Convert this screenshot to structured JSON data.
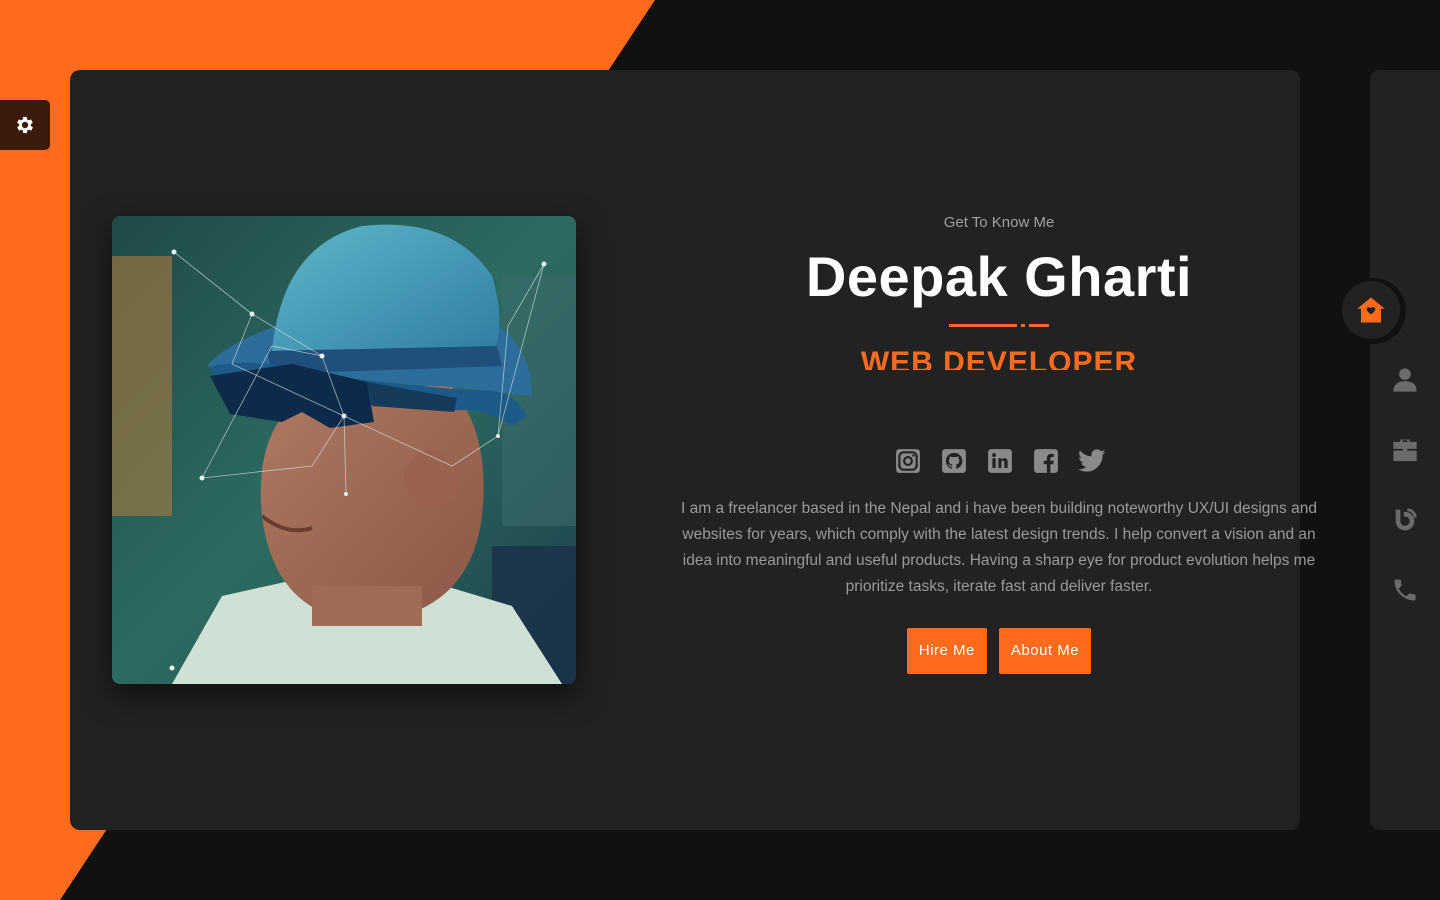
{
  "hero": {
    "eyebrow": "Get To Know Me",
    "name": "Deepak Gharti",
    "role": "WEB DEVELOPER",
    "bio": "I am a freelancer based in the Nepal and i have been building noteworthy UX/UI designs and websites for years, which comply with the latest design trends. I help convert a vision and an idea into meaningful and useful products. Having a sharp eye for product evolution helps me prioritize tasks, iterate fast and deliver faster.",
    "buttons": {
      "hire": "Hire Me",
      "about": "About Me"
    }
  },
  "socials": [
    "instagram-icon",
    "github-icon",
    "linkedin-icon",
    "facebook-icon",
    "twitter-icon"
  ],
  "nav": [
    "home-icon",
    "user-icon",
    "briefcase-icon",
    "blog-icon",
    "phone-icon"
  ],
  "colors": {
    "accent": "#ff6b1c",
    "card": "#222222",
    "background": "#111111",
    "text_muted": "#9a9a9a"
  }
}
